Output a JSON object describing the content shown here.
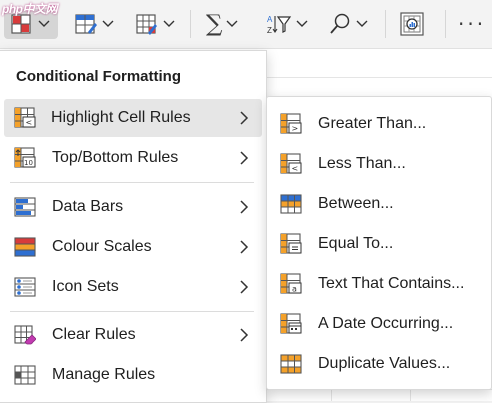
{
  "toolbar": {
    "watermark": "php中文网",
    "buttons": [
      {
        "name": "conditional-formatting",
        "icon": "conditional-formatting-icon",
        "active": true
      },
      {
        "name": "format-as-table",
        "icon": "format-table-icon"
      },
      {
        "name": "cell-styles",
        "icon": "cell-styles-icon"
      },
      {
        "name": "autosum",
        "icon": "sigma-icon",
        "glyph": "∑"
      },
      {
        "name": "sort-filter",
        "icon": "sort-filter-icon"
      },
      {
        "name": "find-select",
        "icon": "search-icon"
      },
      {
        "name": "analyze-data",
        "icon": "analyze-data-icon"
      },
      {
        "name": "more",
        "icon": "more-icon",
        "glyph": "···"
      }
    ]
  },
  "menu": {
    "title": "Conditional Formatting",
    "items": [
      {
        "label": "Highlight Cell Rules",
        "icon": "highlight-cell-rules-icon",
        "has_submenu": true,
        "hover": true
      },
      {
        "label": "Top/Bottom Rules",
        "icon": "top-bottom-rules-icon",
        "has_submenu": true
      },
      {
        "label": "Data Bars",
        "icon": "data-bars-icon",
        "has_submenu": true
      },
      {
        "label": "Colour Scales",
        "icon": "colour-scales-icon",
        "has_submenu": true
      },
      {
        "label": "Icon Sets",
        "icon": "icon-sets-icon",
        "has_submenu": true
      },
      {
        "label": "Clear Rules",
        "icon": "clear-rules-icon",
        "has_submenu": true
      },
      {
        "label": "Manage Rules",
        "icon": "manage-rules-icon",
        "has_submenu": false
      }
    ]
  },
  "submenu": {
    "items": [
      {
        "label": "Greater Than...",
        "icon": "greater-than-icon"
      },
      {
        "label": "Less Than...",
        "icon": "less-than-icon"
      },
      {
        "label": "Between...",
        "icon": "between-icon"
      },
      {
        "label": "Equal To...",
        "icon": "equal-to-icon"
      },
      {
        "label": "Text That Contains...",
        "icon": "text-contains-icon"
      },
      {
        "label": "A Date Occurring...",
        "icon": "date-occurring-icon"
      },
      {
        "label": "Duplicate Values...",
        "icon": "duplicate-values-icon"
      }
    ]
  },
  "colors": {
    "accent_orange": "#f4a12a",
    "accent_blue": "#2e6fd1",
    "accent_red": "#d83b3b",
    "hover_bg": "#e6e6e6"
  }
}
